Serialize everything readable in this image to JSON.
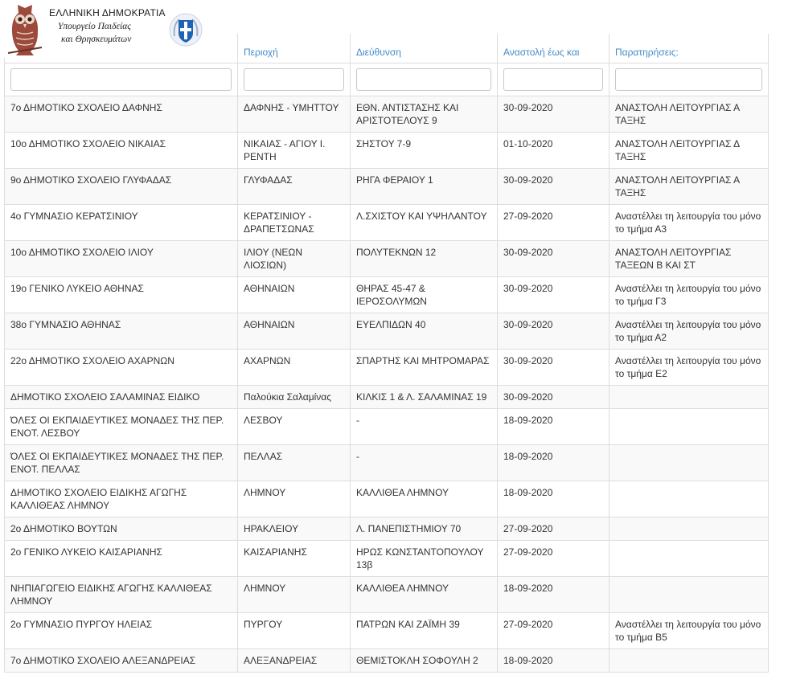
{
  "header": {
    "title": "ΕΛΛΗΝΙΚΗ ΔΗΜΟΚΡΑΤΙΑ",
    "subtitle_line1": "Υπουργείο Παιδείας",
    "subtitle_line2": "και Θρησκευμάτων"
  },
  "table": {
    "columns": [
      "Περιοχή",
      "Διεύθυνση",
      "Αναστολή έως και",
      "Παρατηρήσεις:"
    ],
    "rows": [
      [
        "7ο ΔΗΜΟΤΙΚΟ ΣΧΟΛΕΙΟ ΔΑΦΝΗΣ",
        "ΔΑΦΝΗΣ - ΥΜΗΤΤΟΥ",
        "ΕΘΝ. ΑΝΤΙΣΤΑΣΗΣ ΚΑΙ ΑΡΙΣΤΟΤΕΛΟΥΣ 9",
        "30-09-2020",
        "ΑΝΑΣΤΟΛΗ ΛΕΙΤΟΥΡΓΙΑΣ Α ΤΑΞΗΣ"
      ],
      [
        "10ο ΔΗΜΟΤΙΚΟ ΣΧΟΛΕΙΟ ΝΙΚΑΙΑΣ",
        "ΝΙΚΑΙΑΣ - ΑΓΙΟΥ Ι. ΡΕΝΤΗ",
        "ΣΗΣΤΟΥ 7-9",
        "01-10-2020",
        "ΑΝΑΣΤΟΛΗ ΛΕΙΤΟΥΡΓΙΑΣ Δ ΤΑΞΗΣ"
      ],
      [
        "9ο ΔΗΜΟΤΙΚΟ ΣΧΟΛΕΙΟ ΓΛΥΦΑΔΑΣ",
        "ΓΛΥΦΑΔΑΣ",
        "ΡΗΓΑ ΦΕΡΑΙΟΥ 1",
        "30-09-2020",
        "ΑΝΑΣΤΟΛΗ ΛΕΙΤΟΥΡΓΙΑΣ Α ΤΑΞΗΣ"
      ],
      [
        "4ο ΓΥΜΝΑΣΙΟ ΚΕΡΑΤΣΙΝΙΟΥ",
        "ΚΕΡΑΤΣΙΝΙΟΥ - ΔΡΑΠΕΤΣΩΝΑΣ",
        "Λ.ΣΧΙΣΤΟΥ ΚΑΙ ΥΨΗΛΑΝΤΟΥ",
        "27-09-2020",
        "Αναστέλλει τη λειτουργία του μόνο το τμήμα Α3"
      ],
      [
        "10ο ΔΗΜΟΤΙΚΟ ΣΧΟΛΕΙΟ ΙΛΙΟΥ",
        "ΙΛΙΟΥ (ΝΕΩΝ ΛΙΟΣΙΩΝ)",
        "ΠΟΛΥΤΕΚΝΩΝ 12",
        "30-09-2020",
        "ΑΝΑΣΤΟΛΗ ΛΕΙΤΟΥΡΓΙΑΣ ΤΑΞΕΩΝ Β ΚΑΙ ΣΤ"
      ],
      [
        "19ο ΓΕΝΙΚΟ ΛΥΚΕΙΟ ΑΘΗΝΑΣ",
        "ΑΘΗΝΑΙΩΝ",
        "ΘΗΡΑΣ 45-47 & ΙΕΡΟΣΟΛΥΜΩΝ",
        "30-09-2020",
        "Αναστέλλει τη λειτουργία του μόνο το τμήμα Γ3"
      ],
      [
        "38ο ΓΥΜΝΑΣΙΟ ΑΘΗΝΑΣ",
        "ΑΘΗΝΑΙΩΝ",
        "ΕΥΕΛΠΙΔΩΝ 40",
        "30-09-2020",
        "Αναστέλλει τη λειτουργία του μόνο το τμήμα Α2"
      ],
      [
        "22ο ΔΗΜΟΤΙΚΟ ΣΧΟΛΕΙΟ ΑΧΑΡΝΩΝ",
        "ΑΧΑΡΝΩΝ",
        "ΣΠΑΡΤΗΣ ΚΑΙ ΜΗΤΡΟΜΑΡΑΣ",
        "30-09-2020",
        "Αναστέλλει τη λειτουργία του μόνο το τμήμα Ε2"
      ],
      [
        "ΔΗΜΟΤΙΚΟ ΣΧΟΛΕΙΟ ΣΑΛΑΜΙΝΑΣ ΕΙΔΙΚΟ",
        "Παλούκια Σαλαμίνας",
        "ΚΙΛΚΙΣ 1 & Λ. ΣΑΛΑΜΙΝΑΣ 19",
        "30-09-2020",
        ""
      ],
      [
        "ΌΛΕΣ ΟΙ ΕΚΠΑΙΔΕΥΤΙΚΕΣ ΜΟΝΑΔΕΣ ΤΗΣ ΠΕΡ. ΕΝΟΤ. ΛΕΣΒΟΥ",
        "ΛΕΣΒΟΥ",
        "-",
        "18-09-2020",
        ""
      ],
      [
        "ΌΛΕΣ ΟΙ ΕΚΠΑΙΔΕΥΤΙΚΕΣ ΜΟΝΑΔΕΣ ΤΗΣ ΠΕΡ. ΕΝΟΤ. ΠΕΛΛΑΣ",
        "ΠΕΛΛΑΣ",
        "-",
        "18-09-2020",
        ""
      ],
      [
        "ΔΗΜΟΤΙΚΟ ΣΧΟΛΕΙΟ ΕΙΔΙΚΗΣ ΑΓΩΓΗΣ ΚΑΛΛΙΘΕΑΣ ΛΗΜΝΟΥ",
        "ΛΗΜΝΟΥ",
        "ΚΑΛΛΙΘΕΑ ΛΗΜΝΟΥ",
        "18-09-2020",
        ""
      ],
      [
        "2ο ΔΗΜΟΤΙΚΟ ΒΟΥΤΩΝ",
        "ΗΡΑΚΛΕΙΟΥ",
        "Λ. ΠΑΝΕΠΙΣΤΗΜΙΟΥ 70",
        "27-09-2020",
        ""
      ],
      [
        "2ο ΓΕΝΙΚΟ ΛΥΚΕΙΟ ΚΑΙΣΑΡΙΑΝΗΣ",
        "ΚΑΙΣΑΡΙΑΝΗΣ",
        "ΗΡΩΣ ΚΩΝΣΤΑΝΤΟΠΟΥΛΟΥ 13β",
        "27-09-2020",
        ""
      ],
      [
        "ΝΗΠΙΑΓΩΓΕΙΟ ΕΙΔΙΚΗΣ ΑΓΩΓΗΣ ΚΑΛΛΙΘΕΑΣ ΛΗΜΝΟΥ",
        "ΛΗΜΝΟΥ",
        "ΚΑΛΛΙΘΕΑ ΛΗΜΝΟΥ",
        "18-09-2020",
        ""
      ],
      [
        "2ο ΓΥΜΝΑΣΙΟ ΠΥΡΓΟΥ ΗΛΕΙΑΣ",
        "ΠΥΡΓΟΥ",
        "ΠΑΤΡΩΝ ΚΑΙ ΖΑΪΜΗ 39",
        "27-09-2020",
        "Αναστέλλει τη λειτουργία του μόνο το τμήμα Β5"
      ],
      [
        "7ο ΔΗΜΟΤΙΚΟ ΣΧΟΛΕΙΟ ΑΛΕΞΑΝΔΡΕΙΑΣ",
        "ΑΛΕΞΑΝΔΡΕΙΑΣ",
        "ΘΕΜΙΣΤΟΚΛΗ ΣΟΦΟΥΛΗ 2",
        "18-09-2020",
        ""
      ]
    ]
  }
}
